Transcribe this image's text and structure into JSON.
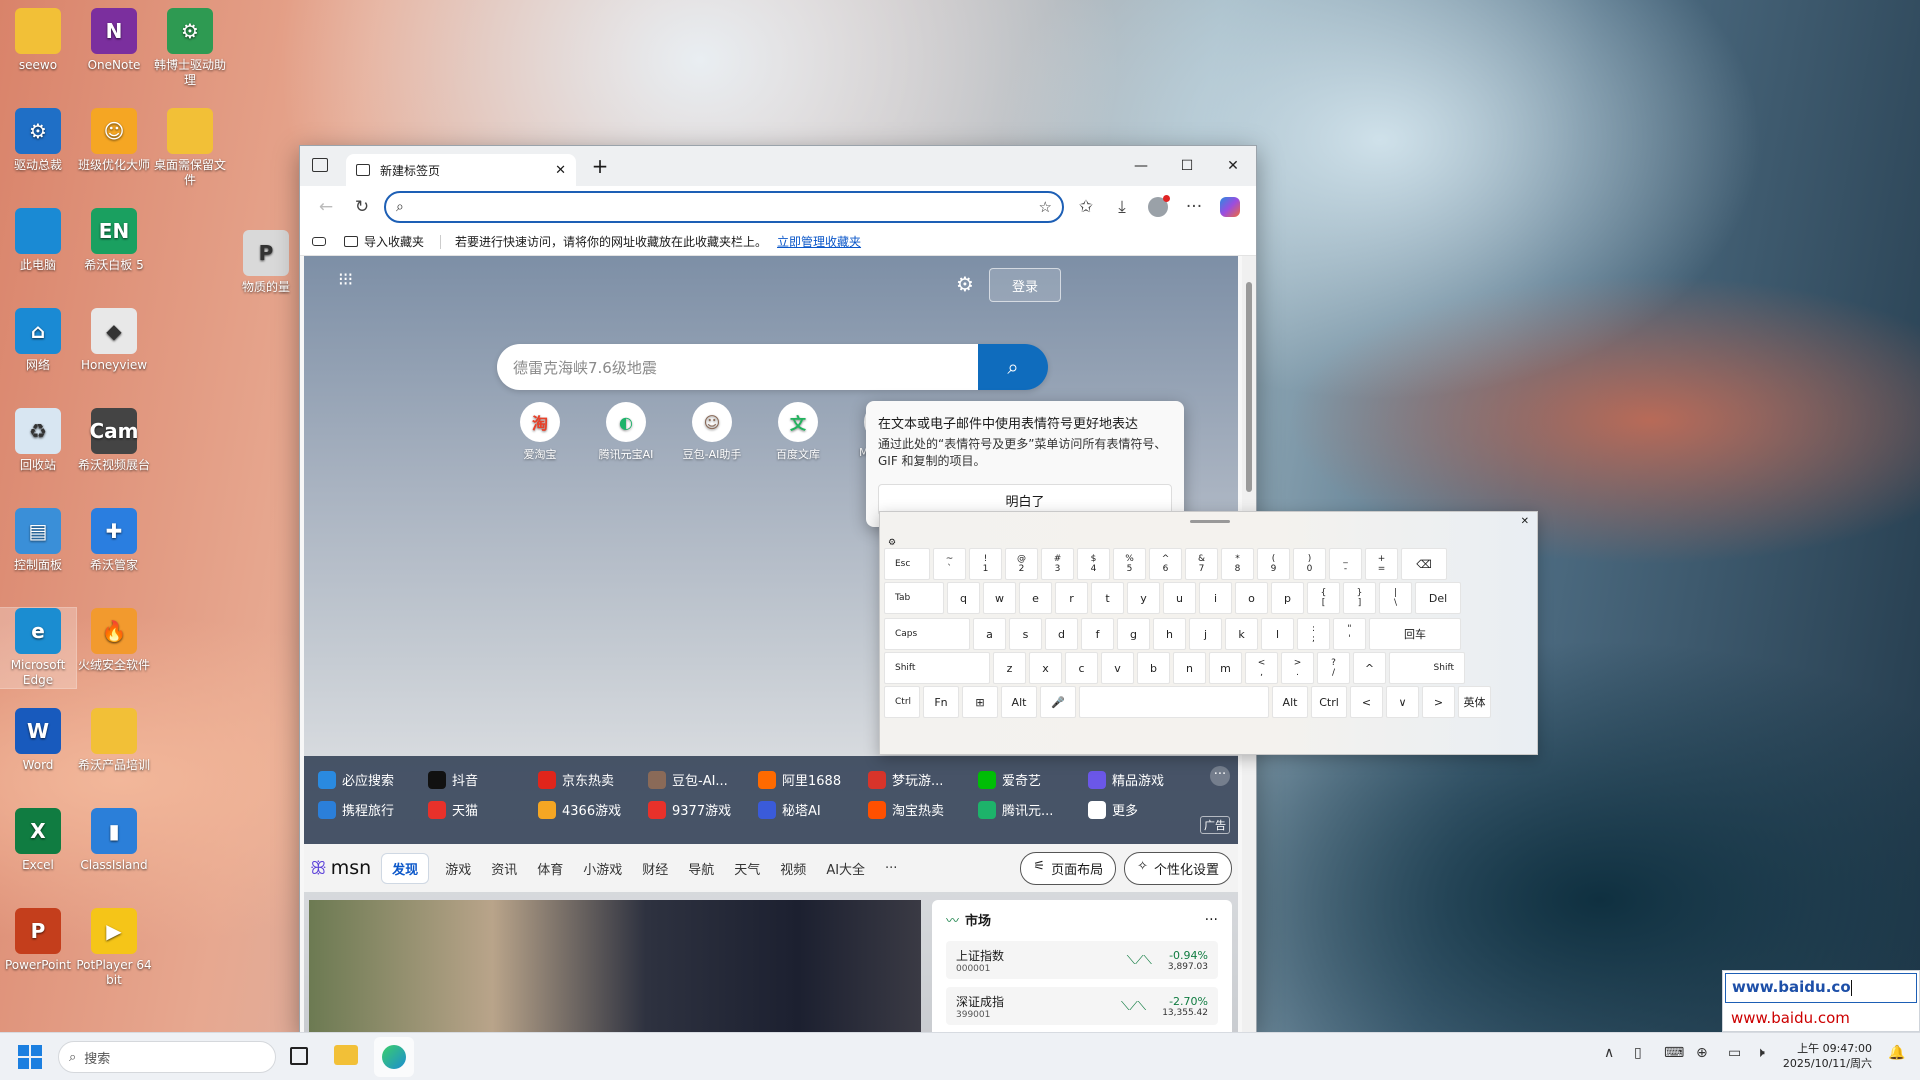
{
  "desktop": {
    "icons": [
      {
        "label": "seewo",
        "icon": "folder-icon",
        "color": "#f2c037"
      },
      {
        "label": "OneNote",
        "icon": "onenote-icon",
        "color": "#7b2f9e"
      },
      {
        "label": "韩博士驱动助理",
        "icon": "gear-icon",
        "color": "#2e9a52"
      },
      {
        "label": "驱动总裁",
        "icon": "driver-icon",
        "color": "#1f6fc6"
      },
      {
        "label": "班级优化大师",
        "icon": "mascot-icon",
        "color": "#f5a623"
      },
      {
        "label": "桌面需保留文件",
        "icon": "folder-icon",
        "color": "#f2c037"
      },
      {
        "label": "此电脑",
        "icon": "monitor-icon",
        "color": "#1a8ad4"
      },
      {
        "label": "希沃白板 5",
        "icon": "en-icon",
        "color": "#1aa060"
      },
      {
        "label": "物质的量",
        "icon": "pptx-file-icon",
        "color": "#d9d9d9"
      },
      {
        "label": "网络",
        "icon": "network-icon",
        "color": "#1a8ad4"
      },
      {
        "label": "Honeyview",
        "icon": "honeyview-icon",
        "color": "#e8e8e8"
      },
      {
        "label": "回收站",
        "icon": "recycle-bin-icon",
        "color": "#d8e6f2"
      },
      {
        "label": "希沃视频展台",
        "icon": "camera-icon",
        "color": "#444444"
      },
      {
        "label": "控制面板",
        "icon": "control-panel-icon",
        "color": "#3a8fd8"
      },
      {
        "label": "希沃管家",
        "icon": "shield-icon",
        "color": "#2a7ee0"
      },
      {
        "label": "Microsoft Edge",
        "icon": "edge-icon",
        "color": "#1b8dd1"
      },
      {
        "label": "火绒安全软件",
        "icon": "fire-shield-icon",
        "color": "#f29a2e"
      },
      {
        "label": "Word",
        "icon": "word-icon",
        "color": "#185abd"
      },
      {
        "label": "希沃产品培训",
        "icon": "folder-icon",
        "color": "#f2c037"
      },
      {
        "label": "Excel",
        "icon": "excel-icon",
        "color": "#107c41"
      },
      {
        "label": "ClassIsland",
        "icon": "classisland-icon",
        "color": "#2b7fd9"
      },
      {
        "label": "PowerPoint",
        "icon": "powerpoint-icon",
        "color": "#c43e1c"
      },
      {
        "label": "PotPlayer 64 bit",
        "icon": "potplayer-icon",
        "color": "#f5c518"
      }
    ]
  },
  "browser": {
    "tab_title": "新建标签页",
    "fav_import": "导入收藏夹",
    "fav_hint": "若要进行快速访问，请将你的网址收藏放在此收藏夹栏上。",
    "fav_manage": "立即管理收藏夹",
    "login": "登录",
    "search_placeholder": "德雷克海峡7.6级地震",
    "quick_links": [
      {
        "label": "爱淘宝",
        "glyph": "淘",
        "color": "#e8412a"
      },
      {
        "label": "腾讯元宝AI",
        "glyph": "◐",
        "color": "#1db36a"
      },
      {
        "label": "豆包-AI助手",
        "glyph": "☺",
        "color": "#8a6a58"
      },
      {
        "label": "百度文库",
        "glyph": "文",
        "color": "#22b35e"
      },
      {
        "label": "Microsoft",
        "glyph": "■",
        "color": "#f25022"
      }
    ],
    "links": [
      {
        "label": "必应搜索",
        "color": "#2a8ae0"
      },
      {
        "label": "抖音",
        "color": "#111111"
      },
      {
        "label": "京东热卖",
        "color": "#e1251b"
      },
      {
        "label": "豆包-AI...",
        "color": "#8a6a58"
      },
      {
        "label": "阿里1688",
        "color": "#ff6a00"
      },
      {
        "label": "梦玩游...",
        "color": "#d8342a"
      },
      {
        "label": "爱奇艺",
        "color": "#00be06"
      },
      {
        "label": "精品游戏",
        "color": "#6b57e8"
      },
      {
        "label": "携程旅行",
        "color": "#2b7fd9"
      },
      {
        "label": "天猫",
        "color": "#e8312a"
      },
      {
        "label": "4366游戏",
        "color": "#f5a623"
      },
      {
        "label": "9377游戏",
        "color": "#e8312a"
      },
      {
        "label": "秘塔AI",
        "color": "#3a5bd9"
      },
      {
        "label": "淘宝热卖",
        "color": "#ff5000"
      },
      {
        "label": "腾讯元...",
        "color": "#1db36a"
      },
      {
        "label": "更多",
        "color": "#ffffff"
      }
    ],
    "ad_badge": "广告",
    "msn": {
      "logo": "msn",
      "tabs": [
        "发现",
        "游戏",
        "资讯",
        "体育",
        "小游戏",
        "财经",
        "导航",
        "天气",
        "视频",
        "AI大全",
        "···"
      ],
      "layout_btn": "页面布局",
      "personalize_btn": "个性化设置"
    },
    "market": {
      "title": "市场",
      "rows": [
        {
          "name": "上证指数",
          "code": "000001",
          "change": "-0.94%",
          "value": "3,897.03"
        },
        {
          "name": "深证成指",
          "code": "399001",
          "change": "-2.70%",
          "value": "13,355.42"
        }
      ]
    }
  },
  "popup": {
    "title": "在文本或电子邮件中使用表情符号更好地表达",
    "body": "通过此处的“表情符号及更多”菜单访问所有表情符号、GIF 和复制的项目。",
    "button": "明白了"
  },
  "keyboard": {
    "row1": [
      [
        "Esc",
        ""
      ],
      [
        "~",
        "`"
      ],
      [
        "!",
        "1"
      ],
      [
        "@",
        "2"
      ],
      [
        "#",
        "3"
      ],
      [
        "$",
        "4"
      ],
      [
        "%",
        "5"
      ],
      [
        "^",
        "6"
      ],
      [
        "&",
        "7"
      ],
      [
        "*",
        "8"
      ],
      [
        "(",
        "9"
      ],
      [
        ")",
        "0"
      ],
      [
        "_",
        "-"
      ],
      [
        "+",
        "="
      ],
      [
        "⌫",
        ""
      ]
    ],
    "row2": [
      [
        "Tab",
        ""
      ],
      [
        "q",
        ""
      ],
      [
        "w",
        ""
      ],
      [
        "e",
        ""
      ],
      [
        "r",
        ""
      ],
      [
        "t",
        ""
      ],
      [
        "y",
        ""
      ],
      [
        "u",
        ""
      ],
      [
        "i",
        ""
      ],
      [
        "o",
        ""
      ],
      [
        "p",
        ""
      ],
      [
        "{",
        "["
      ],
      [
        "}",
        "]"
      ],
      [
        "|",
        "\\"
      ],
      [
        "Del",
        ""
      ]
    ],
    "row3": [
      [
        "Caps",
        ""
      ],
      [
        "a",
        ""
      ],
      [
        "s",
        ""
      ],
      [
        "d",
        ""
      ],
      [
        "f",
        ""
      ],
      [
        "g",
        ""
      ],
      [
        "h",
        ""
      ],
      [
        "j",
        ""
      ],
      [
        "k",
        ""
      ],
      [
        "l",
        ""
      ],
      [
        ":",
        ";"
      ],
      [
        "\"",
        "'"
      ],
      [
        "回车",
        ""
      ]
    ],
    "row4": [
      [
        "Shift",
        ""
      ],
      [
        "z",
        ""
      ],
      [
        "x",
        ""
      ],
      [
        "c",
        ""
      ],
      [
        "v",
        ""
      ],
      [
        "b",
        ""
      ],
      [
        "n",
        ""
      ],
      [
        "m",
        ""
      ],
      [
        "<",
        ","
      ],
      [
        ">",
        "."
      ],
      [
        "?",
        "/"
      ],
      [
        "^",
        ""
      ],
      [
        "Shift",
        ""
      ]
    ],
    "row5": [
      [
        "Ctrl",
        ""
      ],
      [
        "Fn",
        ""
      ],
      [
        "⊞",
        ""
      ],
      [
        "Alt",
        ""
      ],
      [
        "🎤",
        ""
      ],
      [
        "",
        ""
      ],
      [
        "Alt",
        ""
      ],
      [
        "Ctrl",
        ""
      ],
      [
        "<",
        ""
      ],
      [
        "∨",
        ""
      ],
      [
        ">",
        ""
      ],
      [
        "英体",
        ""
      ]
    ]
  },
  "baidu": {
    "input": "www.baidu.co",
    "suggestion": "www.baidu.com"
  },
  "taskbar": {
    "search_placeholder": "搜索",
    "time": "上午 09:47:00",
    "date": "2025/10/11/周六"
  }
}
